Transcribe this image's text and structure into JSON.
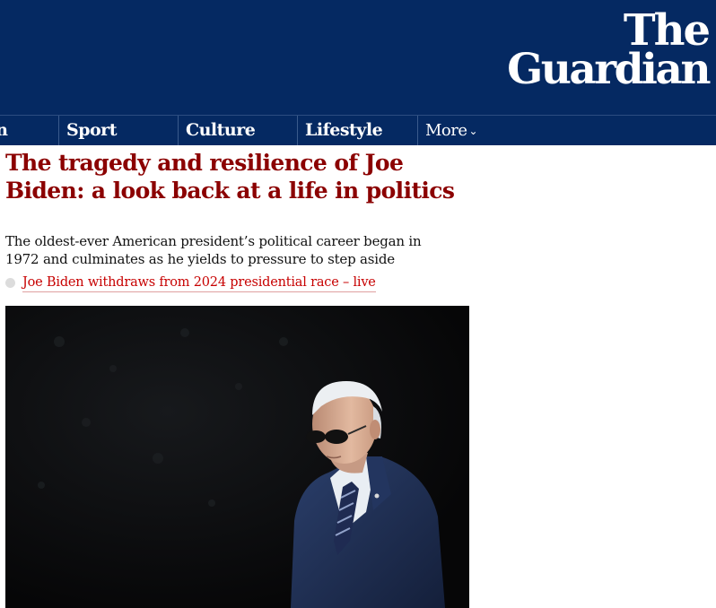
{
  "masthead": {
    "logo_line1": "The",
    "logo_line2": "Guardian",
    "background_color": "#052962"
  },
  "nav": {
    "items": [
      {
        "label": "on"
      },
      {
        "label": "Sport"
      },
      {
        "label": "Culture"
      },
      {
        "label": "Lifestyle"
      },
      {
        "label": "More"
      }
    ],
    "more_icon": "chevron-down-icon"
  },
  "article": {
    "headline": "The tragedy and resilience of Joe Biden: a look back at a life in politics",
    "headline_color": "#8b0000",
    "standfirst": "The oldest-ever American president’s political career began in 1972 and culminates as he yields to pressure to step aside",
    "related_link": "Joe Biden withdraws from 2024 presidential race – live",
    "related_link_color": "#c70000"
  },
  "image": {
    "subject": "photo-of-man-in-suit-and-sunglasses"
  }
}
